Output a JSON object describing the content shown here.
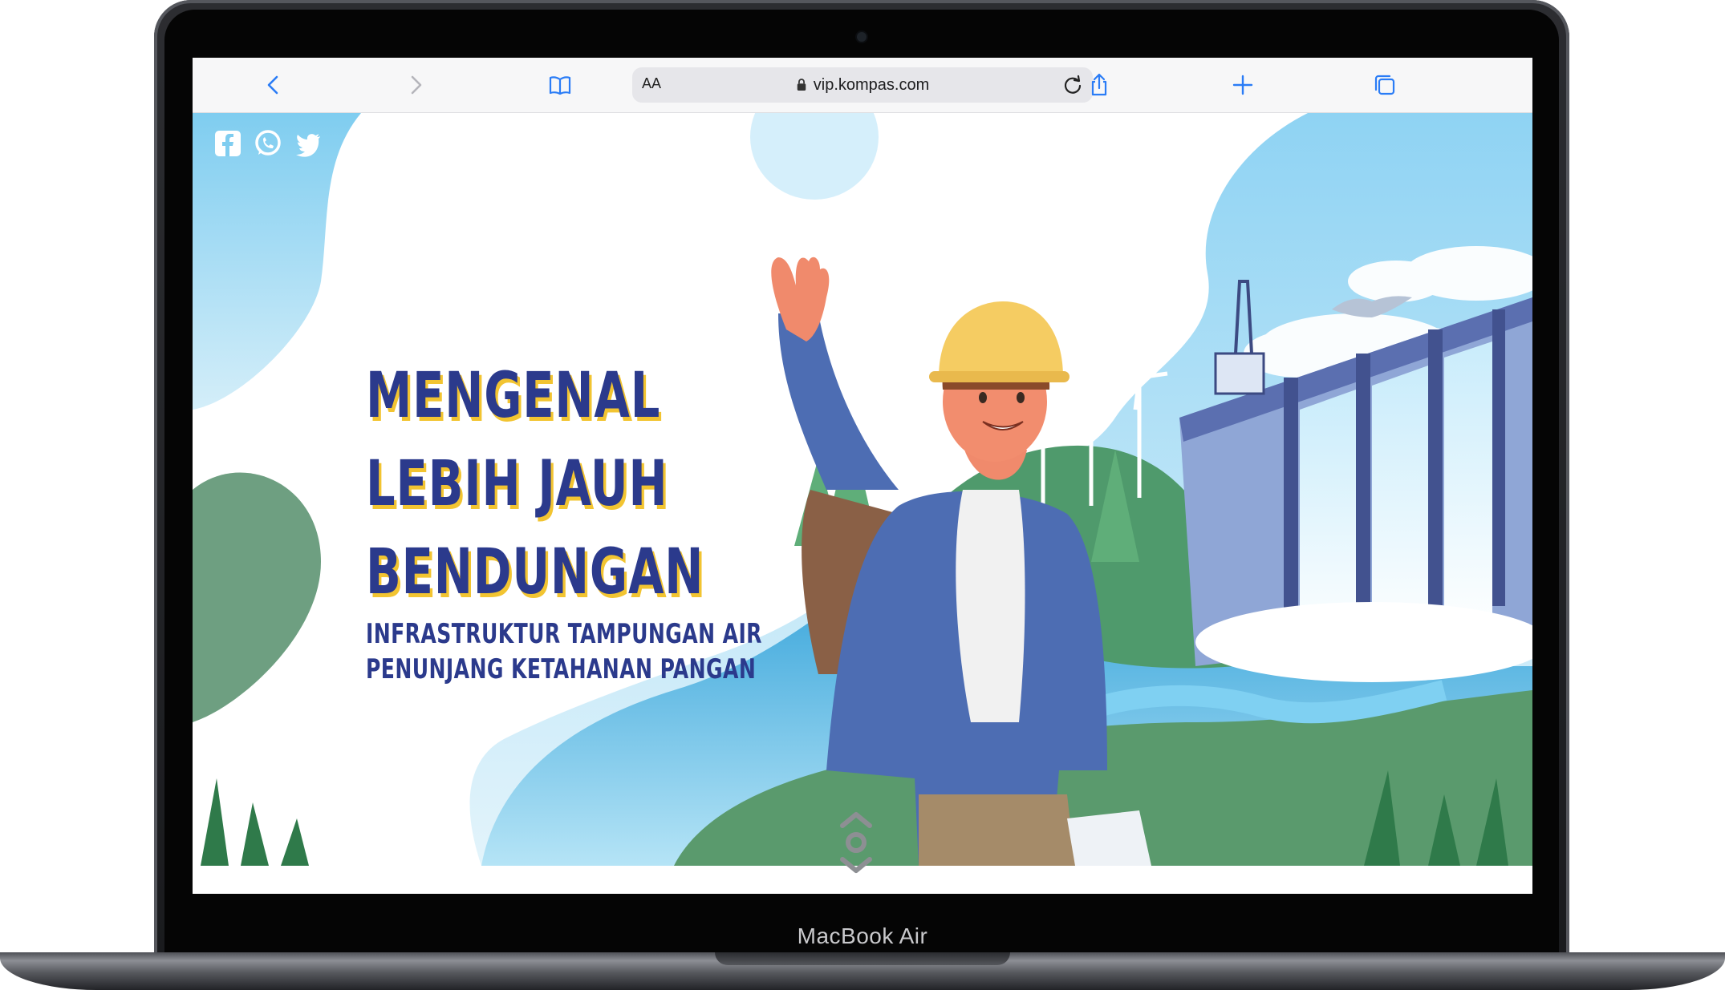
{
  "device": {
    "label": "MacBook Air"
  },
  "browser": {
    "url": "vip.kompas.com",
    "aa_label": "AA",
    "buttons": [
      "back-icon",
      "forward-icon",
      "bookmarks-icon",
      "share-icon",
      "new-tab-icon",
      "tabs-icon"
    ]
  },
  "social": [
    "facebook-icon",
    "whatsapp-icon",
    "twitter-icon"
  ],
  "headline": {
    "line1": "MENGENAL",
    "line2": "LEBIH JAUH",
    "line3": "BENDUNGAN",
    "sub1": "INFRASTRUKTUR TAMPUNGAN AIR",
    "sub2": "PENUNJANG KETAHANAN PANGAN"
  },
  "colors": {
    "headline": "#2b3a8c",
    "headline_shadow": "#f2c431",
    "sky": "#aee0f5",
    "water": "#4fb6e3",
    "grass": "#5a9a6d",
    "dam": "#8fa6d6"
  }
}
